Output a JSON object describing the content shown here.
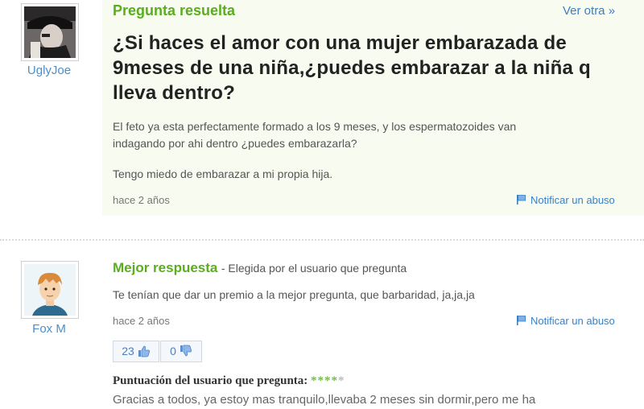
{
  "question": {
    "header": "Pregunta resuelta",
    "see_other": "Ver otra »",
    "user": "UglyJoe",
    "title": "¿Si haces el amor con una mujer embarazada de 9meses de una niña,¿puedes embarazar a la niña q lleva dentro?",
    "body_line1": "El feto ya esta perfectamente formado a los 9 meses, y los espermatozoides van",
    "body_line2": "indagando por ahi dentro ¿puedes embarazarla?",
    "body_line3": "Tengo miedo de embarazar a mi propia hija.",
    "time": "hace 2 años",
    "report": "Notificar un abuso"
  },
  "best_answer": {
    "label": "Mejor respuesta",
    "chosen_by": "- Elegida por el usuario que pregunta",
    "user": "Fox M",
    "text": "Te tenían que dar un premio a la mejor pregunta, que barbaridad, ja,ja,ja",
    "time": "hace 2 años",
    "report": "Notificar un abuso",
    "votes_up": "23",
    "votes_down": "0",
    "rating_label": "Puntuación del usuario que pregunta:",
    "rating_stars": 4,
    "rating_max": 5,
    "comment": "Gracias a todos, ya estoy mas tranquilo,llevaba 2 meses sin dormir,pero me ha"
  },
  "colors": {
    "green": "#5aae1e",
    "link_blue": "#3a7fc3",
    "question_bg": "#f7fbf0"
  }
}
